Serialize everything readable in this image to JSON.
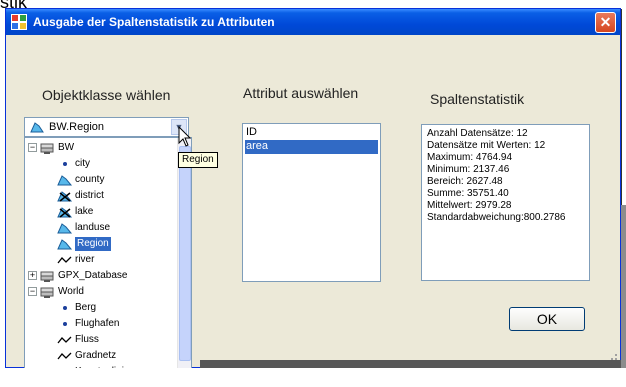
{
  "top_fragment": "stik",
  "window": {
    "title": "Ausgabe der Spaltenstatistik zu Attributen",
    "close_glyph": "✕"
  },
  "labels": {
    "objektklasse": "Objektklasse wählen",
    "attribut": "Attribut auswählen",
    "statistik": "Spaltenstatistik"
  },
  "combo": {
    "value": "BW.Region",
    "icon": "polygon-icon",
    "arrow_glyph": "▼"
  },
  "tree": {
    "items": [
      {
        "label": "BW",
        "kind": "database",
        "expander": "−",
        "level": 0
      },
      {
        "label": "city",
        "kind": "point",
        "level": 1
      },
      {
        "label": "county",
        "kind": "polygon",
        "level": 1
      },
      {
        "label": "district",
        "kind": "polygon-x",
        "level": 1
      },
      {
        "label": "lake",
        "kind": "polygon-x",
        "level": 1
      },
      {
        "label": "landuse",
        "kind": "polygon",
        "level": 1
      },
      {
        "label": "Region",
        "kind": "polygon",
        "level": 1,
        "selected": true
      },
      {
        "label": "river",
        "kind": "line",
        "level": 1
      },
      {
        "label": "GPX_Database",
        "kind": "database",
        "expander": "+",
        "level": 0
      },
      {
        "label": "World",
        "kind": "database",
        "expander": "−",
        "level": 0
      },
      {
        "label": "Berg",
        "kind": "point",
        "level": 1
      },
      {
        "label": "Flughafen",
        "kind": "point",
        "level": 1
      },
      {
        "label": "Fluss",
        "kind": "line",
        "level": 1
      },
      {
        "label": "Gradnetz",
        "kind": "line",
        "level": 1
      },
      {
        "label": "Kuestenlinie",
        "kind": "line",
        "level": 1
      }
    ],
    "scroll_down_glyph": "▼"
  },
  "tooltip": "Region",
  "attributes": {
    "items": [
      {
        "label": "ID",
        "selected": false
      },
      {
        "label": "area",
        "selected": true
      }
    ]
  },
  "stats": {
    "lines": [
      "Anzahl Datensätze: 12",
      "Datensätze mit Werten: 12",
      "Maximum: 4764.94",
      "Minimum: 2137.46",
      "Bereich: 2627.48",
      "Summe: 35751.40",
      "Mittelwert: 2979.28",
      "Standardabweichung:800.2786"
    ]
  },
  "buttons": {
    "ok": "OK"
  },
  "colors": {
    "titlebar": "#0049d8",
    "selection": "#316ac5",
    "dialog_bg": "#ece9d8"
  }
}
